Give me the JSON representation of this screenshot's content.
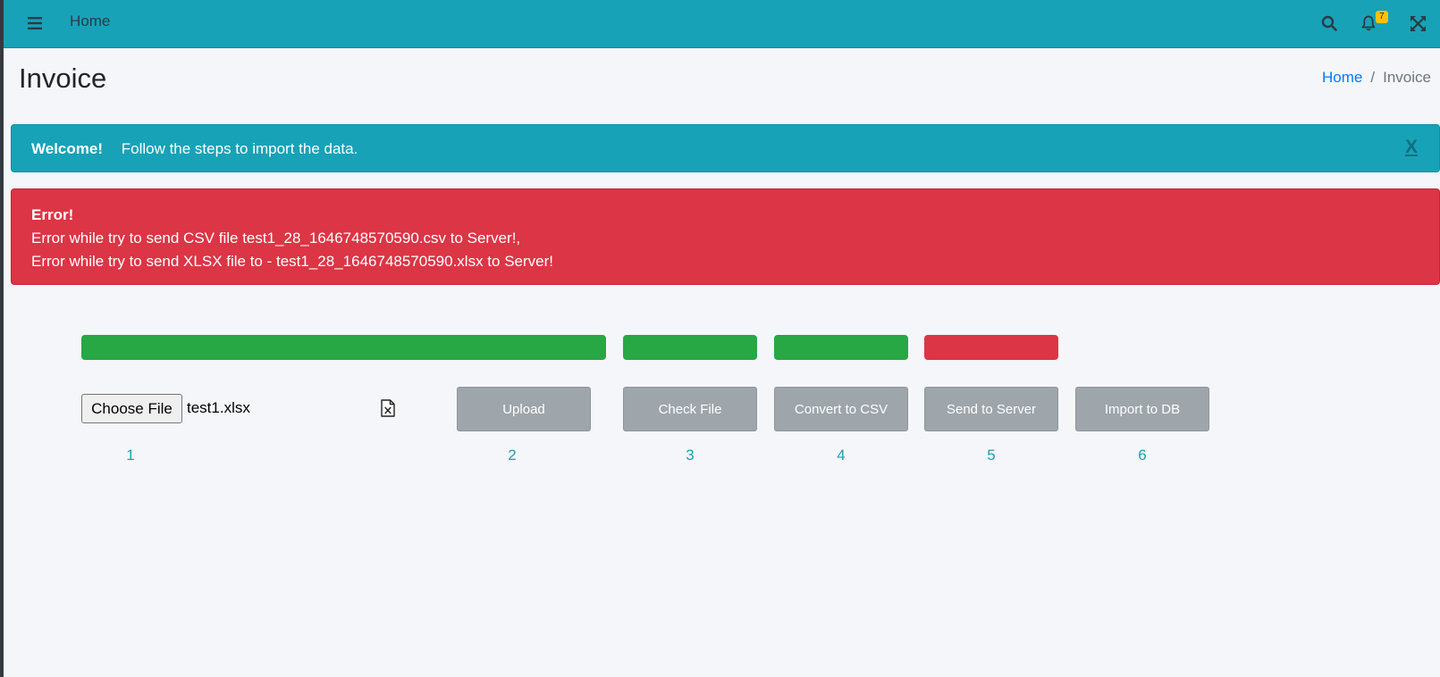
{
  "navbar": {
    "menu_icon": "bars-icon",
    "home_link": "Home",
    "search_icon": "search-icon",
    "bell_icon": "bell-icon",
    "notification_count": "7",
    "fullscreen_icon": "expand-icon"
  },
  "page": {
    "title": "Invoice"
  },
  "breadcrumb": {
    "home": "Home",
    "separator": "/",
    "current": "Invoice"
  },
  "alerts": {
    "info": {
      "strong": "Welcome!",
      "message": "Follow the steps to import the data.",
      "close": "X"
    },
    "error": {
      "strong": "Error!",
      "line1": "Error while try to send CSV file test1_28_1646748570590.csv to Server!,",
      "line2": "Error while try to send XLSX file to - test1_28_1646748570590.xlsx to Server!"
    }
  },
  "colors": {
    "primary": "#17a2b8",
    "success": "#28a745",
    "danger": "#dc3545",
    "secondary": "#9ea5ab"
  },
  "progress": [
    {
      "step": 1,
      "status": "success"
    },
    {
      "step": 3,
      "status": "success"
    },
    {
      "step": 4,
      "status": "success"
    },
    {
      "step": 5,
      "status": "danger"
    }
  ],
  "file_input": {
    "button": "Choose File",
    "filename": "test1.xlsx",
    "icon": "excel-file-icon"
  },
  "steps": {
    "upload": "Upload",
    "check": "Check File",
    "convert": "Convert to CSV",
    "send": "Send to Server",
    "import": "Import to DB"
  },
  "step_numbers": [
    "1",
    "2",
    "3",
    "4",
    "5",
    "6"
  ]
}
